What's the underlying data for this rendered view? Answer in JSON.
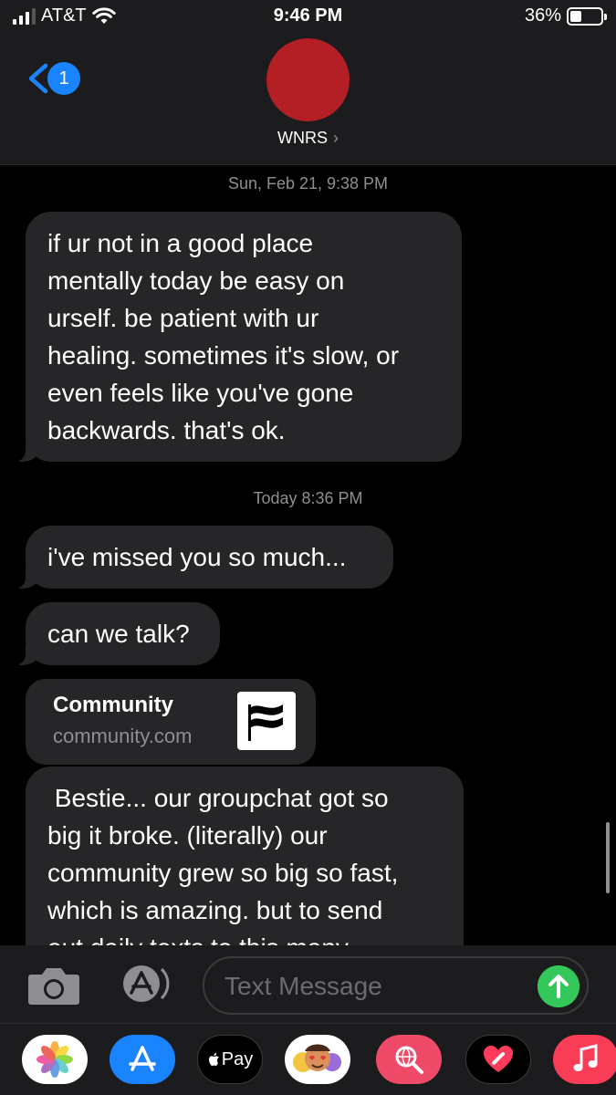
{
  "status_bar": {
    "carrier": "AT&T",
    "time": "9:46 PM",
    "battery_percent": "36%",
    "battery_level": 0.36
  },
  "header": {
    "back_badge": "1",
    "contact_name": "WNRS",
    "avatar_color": "#b31f24"
  },
  "messages": {
    "timestamp1": "Sun, Feb 21, 9:38 PM",
    "bubble1_lines": [
      "if ur not in a good place",
      "mentally today be easy on",
      "urself. be patient with ur",
      "healing. sometimes it's slow, or",
      "even feels like you've gone",
      "backwards. that's ok."
    ],
    "timestamp2": "Today 8:36 PM",
    "bubble2": "i've missed you so much...",
    "bubble3": "can we talk?",
    "link_card": {
      "title": "Community",
      "url": "community.com"
    },
    "bubble4_lines": [
      " Bestie... our groupchat got so",
      "big it broke. (literally) our",
      "community grew so big so fast,",
      "which is amazing. but to send",
      "out daily texts to this many"
    ]
  },
  "input_bar": {
    "placeholder": "Text Message"
  },
  "app_drawer": {
    "apple_pay_label": "Pay",
    "apps": [
      "photos-icon",
      "app-store-icon",
      "apple-pay-icon",
      "memoji-icon",
      "web-search-icon",
      "digital-touch-icon",
      "music-icon"
    ]
  },
  "colors": {
    "accent_blue": "#1a84ff",
    "bubble_gray": "#262628",
    "send_green": "#34c759"
  }
}
